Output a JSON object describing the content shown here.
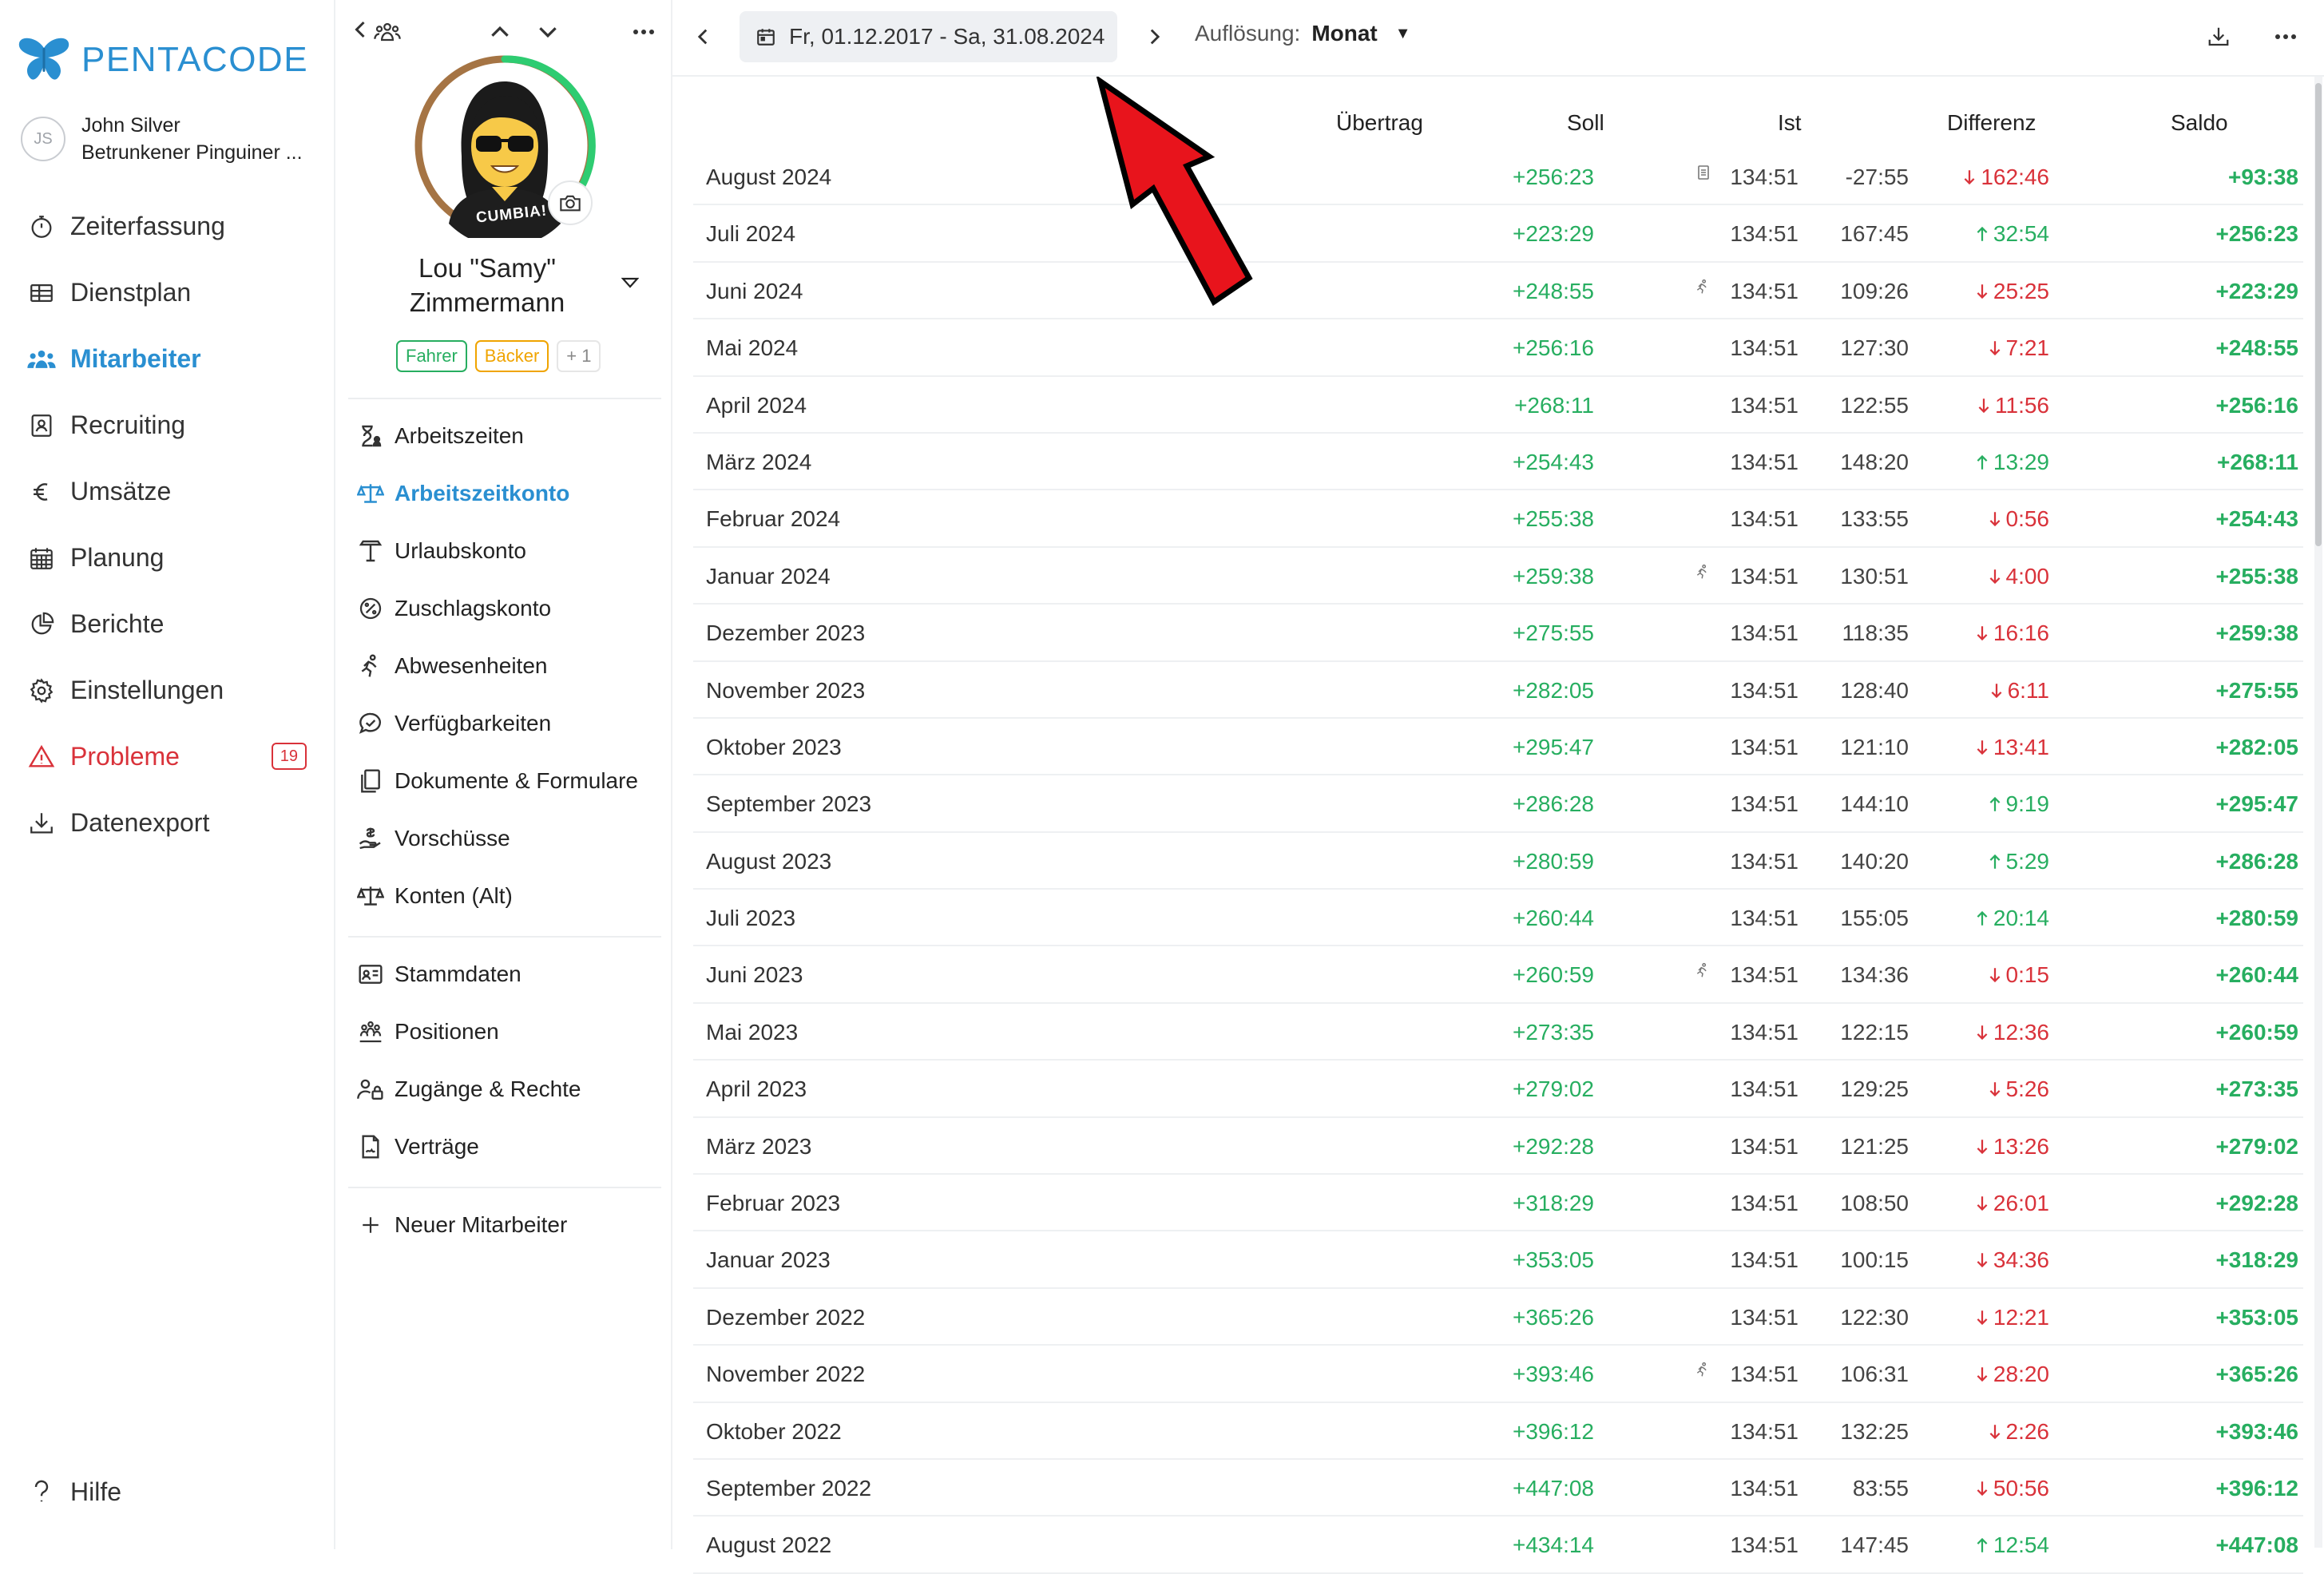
{
  "brand": {
    "name": "PENTACODE",
    "color": "#2a8fd1"
  },
  "user": {
    "initials": "JS",
    "name": "John Silver",
    "company": "Betrunkener Pinguiner ..."
  },
  "nav": [
    {
      "label": "Zeiterfassung",
      "icon": "stopwatch-icon"
    },
    {
      "label": "Dienstplan",
      "icon": "table-icon"
    },
    {
      "label": "Mitarbeiter",
      "icon": "people-icon",
      "active": true
    },
    {
      "label": "Recruiting",
      "icon": "id-card-icon"
    },
    {
      "label": "Umsätze",
      "icon": "euro-icon"
    },
    {
      "label": "Planung",
      "icon": "calendar-grid-icon"
    },
    {
      "label": "Berichte",
      "icon": "pie-chart-icon"
    },
    {
      "label": "Einstellungen",
      "icon": "gear-icon"
    },
    {
      "label": "Probleme",
      "icon": "warning-icon",
      "badge": "19"
    },
    {
      "label": "Datenexport",
      "icon": "download-icon"
    }
  ],
  "help": {
    "label": "Hilfe",
    "icon": "question-icon"
  },
  "profile": {
    "name_line1": "Lou \"Samy\"",
    "name_line2": "Zimmermann",
    "shirt_text": "CUMBIA!",
    "tags": [
      {
        "label": "Fahrer",
        "style": "green"
      },
      {
        "label": "Bäcker",
        "style": "orange"
      },
      {
        "label": "+ 1",
        "style": "more"
      }
    ],
    "menu_group1": [
      {
        "label": "Arbeitszeiten",
        "icon": "hourglass-person-icon"
      },
      {
        "label": "Arbeitszeitkonto",
        "icon": "scales-icon",
        "active": true
      },
      {
        "label": "Urlaubskonto",
        "icon": "beach-umbrella-icon"
      },
      {
        "label": "Zuschlagskonto",
        "icon": "percent-badge-icon"
      },
      {
        "label": "Abwesenheiten",
        "icon": "running-person-icon"
      },
      {
        "label": "Verfügbarkeiten",
        "icon": "chat-check-icon"
      },
      {
        "label": "Dokumente & Formulare",
        "icon": "documents-icon"
      },
      {
        "label": "Vorschüsse",
        "icon": "hand-money-icon"
      },
      {
        "label": "Konten (Alt)",
        "icon": "scales-old-icon"
      }
    ],
    "menu_group2": [
      {
        "label": "Stammdaten",
        "icon": "contact-card-icon"
      },
      {
        "label": "Positionen",
        "icon": "people-group-icon"
      },
      {
        "label": "Zugänge & Rechte",
        "icon": "user-lock-icon"
      },
      {
        "label": "Verträge",
        "icon": "contract-icon"
      }
    ],
    "menu_group3": [
      {
        "label": "Neuer Mitarbeiter",
        "icon": "plus-icon"
      }
    ]
  },
  "toolbar": {
    "date_range": "Fr, 01.12.2017 - Sa, 31.08.2024",
    "resolution_label": "Auflösung:",
    "resolution_value": "Monat"
  },
  "table": {
    "headers": {
      "month": "",
      "uebertrag": "Übertrag",
      "soll": "Soll",
      "ist": "Ist",
      "differenz": "Differenz",
      "saldo": "Saldo"
    },
    "rows": [
      {
        "month": "August 2024",
        "uebertrag": "+256:23",
        "soll": "134:51",
        "ist": "-27:55",
        "ist_icon": "document-icon",
        "diff": "162:46",
        "dir": "down",
        "saldo": "+93:38"
      },
      {
        "month": "Juli 2024",
        "uebertrag": "+223:29",
        "soll": "134:51",
        "ist": "167:45",
        "ist_icon": "",
        "diff": "32:54",
        "dir": "up",
        "saldo": "+256:23"
      },
      {
        "month": "Juni 2024",
        "uebertrag": "+248:55",
        "soll": "134:51",
        "ist": "109:26",
        "ist_icon": "running-person-icon",
        "diff": "25:25",
        "dir": "down",
        "saldo": "+223:29"
      },
      {
        "month": "Mai 2024",
        "uebertrag": "+256:16",
        "soll": "134:51",
        "ist": "127:30",
        "ist_icon": "",
        "diff": "7:21",
        "dir": "down",
        "saldo": "+248:55"
      },
      {
        "month": "April 2024",
        "uebertrag": "+268:11",
        "soll": "134:51",
        "ist": "122:55",
        "ist_icon": "",
        "diff": "11:56",
        "dir": "down",
        "saldo": "+256:16"
      },
      {
        "month": "März 2024",
        "uebertrag": "+254:43",
        "soll": "134:51",
        "ist": "148:20",
        "ist_icon": "",
        "diff": "13:29",
        "dir": "up",
        "saldo": "+268:11"
      },
      {
        "month": "Februar 2024",
        "uebertrag": "+255:38",
        "soll": "134:51",
        "ist": "133:55",
        "ist_icon": "",
        "diff": "0:56",
        "dir": "down",
        "saldo": "+254:43"
      },
      {
        "month": "Januar 2024",
        "uebertrag": "+259:38",
        "soll": "134:51",
        "ist": "130:51",
        "ist_icon": "running-person-icon",
        "diff": "4:00",
        "dir": "down",
        "saldo": "+255:38"
      },
      {
        "month": "Dezember 2023",
        "uebertrag": "+275:55",
        "soll": "134:51",
        "ist": "118:35",
        "ist_icon": "",
        "diff": "16:16",
        "dir": "down",
        "saldo": "+259:38"
      },
      {
        "month": "November 2023",
        "uebertrag": "+282:05",
        "soll": "134:51",
        "ist": "128:40",
        "ist_icon": "",
        "diff": "6:11",
        "dir": "down",
        "saldo": "+275:55"
      },
      {
        "month": "Oktober 2023",
        "uebertrag": "+295:47",
        "soll": "134:51",
        "ist": "121:10",
        "ist_icon": "",
        "diff": "13:41",
        "dir": "down",
        "saldo": "+282:05"
      },
      {
        "month": "September 2023",
        "uebertrag": "+286:28",
        "soll": "134:51",
        "ist": "144:10",
        "ist_icon": "",
        "diff": "9:19",
        "dir": "up",
        "saldo": "+295:47"
      },
      {
        "month": "August 2023",
        "uebertrag": "+280:59",
        "soll": "134:51",
        "ist": "140:20",
        "ist_icon": "",
        "diff": "5:29",
        "dir": "up",
        "saldo": "+286:28"
      },
      {
        "month": "Juli 2023",
        "uebertrag": "+260:44",
        "soll": "134:51",
        "ist": "155:05",
        "ist_icon": "",
        "diff": "20:14",
        "dir": "up",
        "saldo": "+280:59"
      },
      {
        "month": "Juni 2023",
        "uebertrag": "+260:59",
        "soll": "134:51",
        "ist": "134:36",
        "ist_icon": "running-person-icon",
        "diff": "0:15",
        "dir": "down",
        "saldo": "+260:44"
      },
      {
        "month": "Mai 2023",
        "uebertrag": "+273:35",
        "soll": "134:51",
        "ist": "122:15",
        "ist_icon": "",
        "diff": "12:36",
        "dir": "down",
        "saldo": "+260:59"
      },
      {
        "month": "April 2023",
        "uebertrag": "+279:02",
        "soll": "134:51",
        "ist": "129:25",
        "ist_icon": "",
        "diff": "5:26",
        "dir": "down",
        "saldo": "+273:35"
      },
      {
        "month": "März 2023",
        "uebertrag": "+292:28",
        "soll": "134:51",
        "ist": "121:25",
        "ist_icon": "",
        "diff": "13:26",
        "dir": "down",
        "saldo": "+279:02"
      },
      {
        "month": "Februar 2023",
        "uebertrag": "+318:29",
        "soll": "134:51",
        "ist": "108:50",
        "ist_icon": "",
        "diff": "26:01",
        "dir": "down",
        "saldo": "+292:28"
      },
      {
        "month": "Januar 2023",
        "uebertrag": "+353:05",
        "soll": "134:51",
        "ist": "100:15",
        "ist_icon": "",
        "diff": "34:36",
        "dir": "down",
        "saldo": "+318:29"
      },
      {
        "month": "Dezember 2022",
        "uebertrag": "+365:26",
        "soll": "134:51",
        "ist": "122:30",
        "ist_icon": "",
        "diff": "12:21",
        "dir": "down",
        "saldo": "+353:05"
      },
      {
        "month": "November 2022",
        "uebertrag": "+393:46",
        "soll": "134:51",
        "ist": "106:31",
        "ist_icon": "running-person-icon",
        "diff": "28:20",
        "dir": "down",
        "saldo": "+365:26"
      },
      {
        "month": "Oktober 2022",
        "uebertrag": "+396:12",
        "soll": "134:51",
        "ist": "132:25",
        "ist_icon": "",
        "diff": "2:26",
        "dir": "down",
        "saldo": "+393:46"
      },
      {
        "month": "September 2022",
        "uebertrag": "+447:08",
        "soll": "134:51",
        "ist": "83:55",
        "ist_icon": "",
        "diff": "50:56",
        "dir": "down",
        "saldo": "+396:12"
      },
      {
        "month": "August 2022",
        "uebertrag": "+434:14",
        "soll": "134:51",
        "ist": "147:45",
        "ist_icon": "",
        "diff": "12:54",
        "dir": "up",
        "saldo": "+447:08"
      }
    ]
  },
  "colors": {
    "positive": "#27ae60",
    "negative": "#d9323a",
    "accent": "#2a8fd1",
    "annotation_arrow": "#e8141c"
  }
}
